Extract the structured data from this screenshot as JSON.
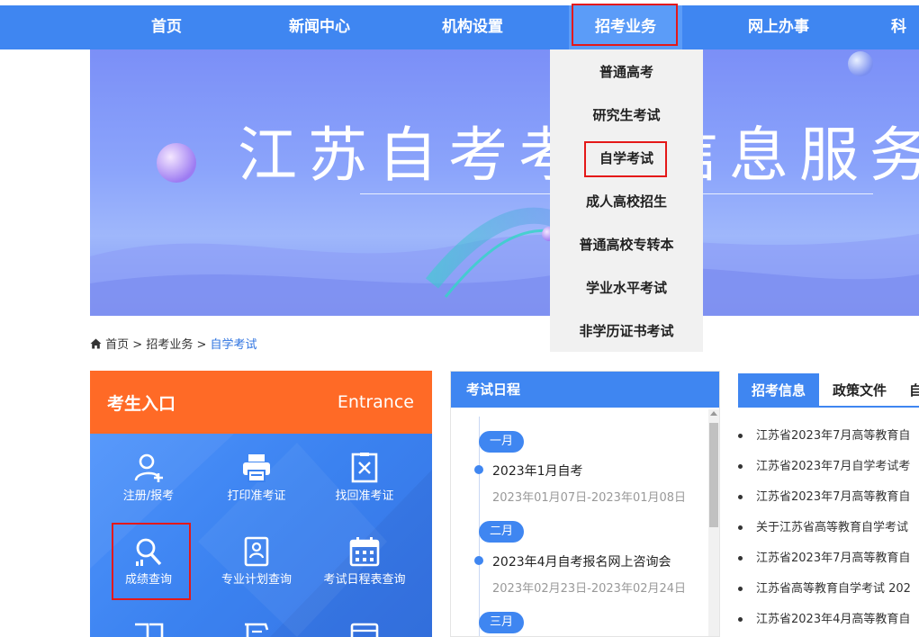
{
  "nav": {
    "items": [
      {
        "label": "首页"
      },
      {
        "label": "新闻中心"
      },
      {
        "label": "机构设置"
      },
      {
        "label": "招考业务"
      },
      {
        "label": "网上办事"
      },
      {
        "label": "科"
      }
    ]
  },
  "banner": {
    "title": "江苏自考考试信息服务平"
  },
  "dropdown": {
    "items": [
      {
        "label": "普通高考"
      },
      {
        "label": "研究生考试"
      },
      {
        "label": "自学考试"
      },
      {
        "label": "成人高校招生"
      },
      {
        "label": "普通高校专转本"
      },
      {
        "label": "学业水平考试"
      },
      {
        "label": "非学历证书考试"
      }
    ]
  },
  "breadcrumb": {
    "home": "首页",
    "sep": ">",
    "level1": "招考业务",
    "current": "自学考试"
  },
  "entrance": {
    "title": "考生入口",
    "title_en": "Entrance",
    "items": [
      {
        "label": "注册/报考",
        "icon": "user-add-icon"
      },
      {
        "label": "打印准考证",
        "icon": "printer-icon"
      },
      {
        "label": "找回准考证",
        "icon": "retrieve-card-icon"
      },
      {
        "label": "成绩查询",
        "icon": "search-score-icon"
      },
      {
        "label": "专业计划查询",
        "icon": "plan-doc-icon"
      },
      {
        "label": "考试日程表查询",
        "icon": "calendar-icon"
      }
    ]
  },
  "schedule": {
    "title": "考试日程",
    "months": [
      {
        "label": "一月",
        "event": "2023年1月自考",
        "date": "2023年01月07日-2023年01月08日"
      },
      {
        "label": "二月",
        "event": "2023年4月自考报名网上咨询会",
        "date": "2023年02月23日-2023年02月24日"
      },
      {
        "label": "三月"
      }
    ]
  },
  "news": {
    "tabs": [
      {
        "label": "招考信息"
      },
      {
        "label": "政策文件"
      },
      {
        "label": "自"
      }
    ],
    "items": [
      "江苏省2023年7月高等教育自",
      "江苏省2023年7月自学考试考",
      "江苏省2023年7月高等教育自",
      "关于江苏省高等教育自学考试",
      "江苏省2023年7月高等教育自",
      "江苏省高等教育自学考试 202",
      "江苏省2023年4月高等教育自"
    ]
  },
  "colors": {
    "nav_bg": "#3f86f1",
    "accent_orange": "#ff6a26",
    "highlight_red": "#e41818"
  }
}
